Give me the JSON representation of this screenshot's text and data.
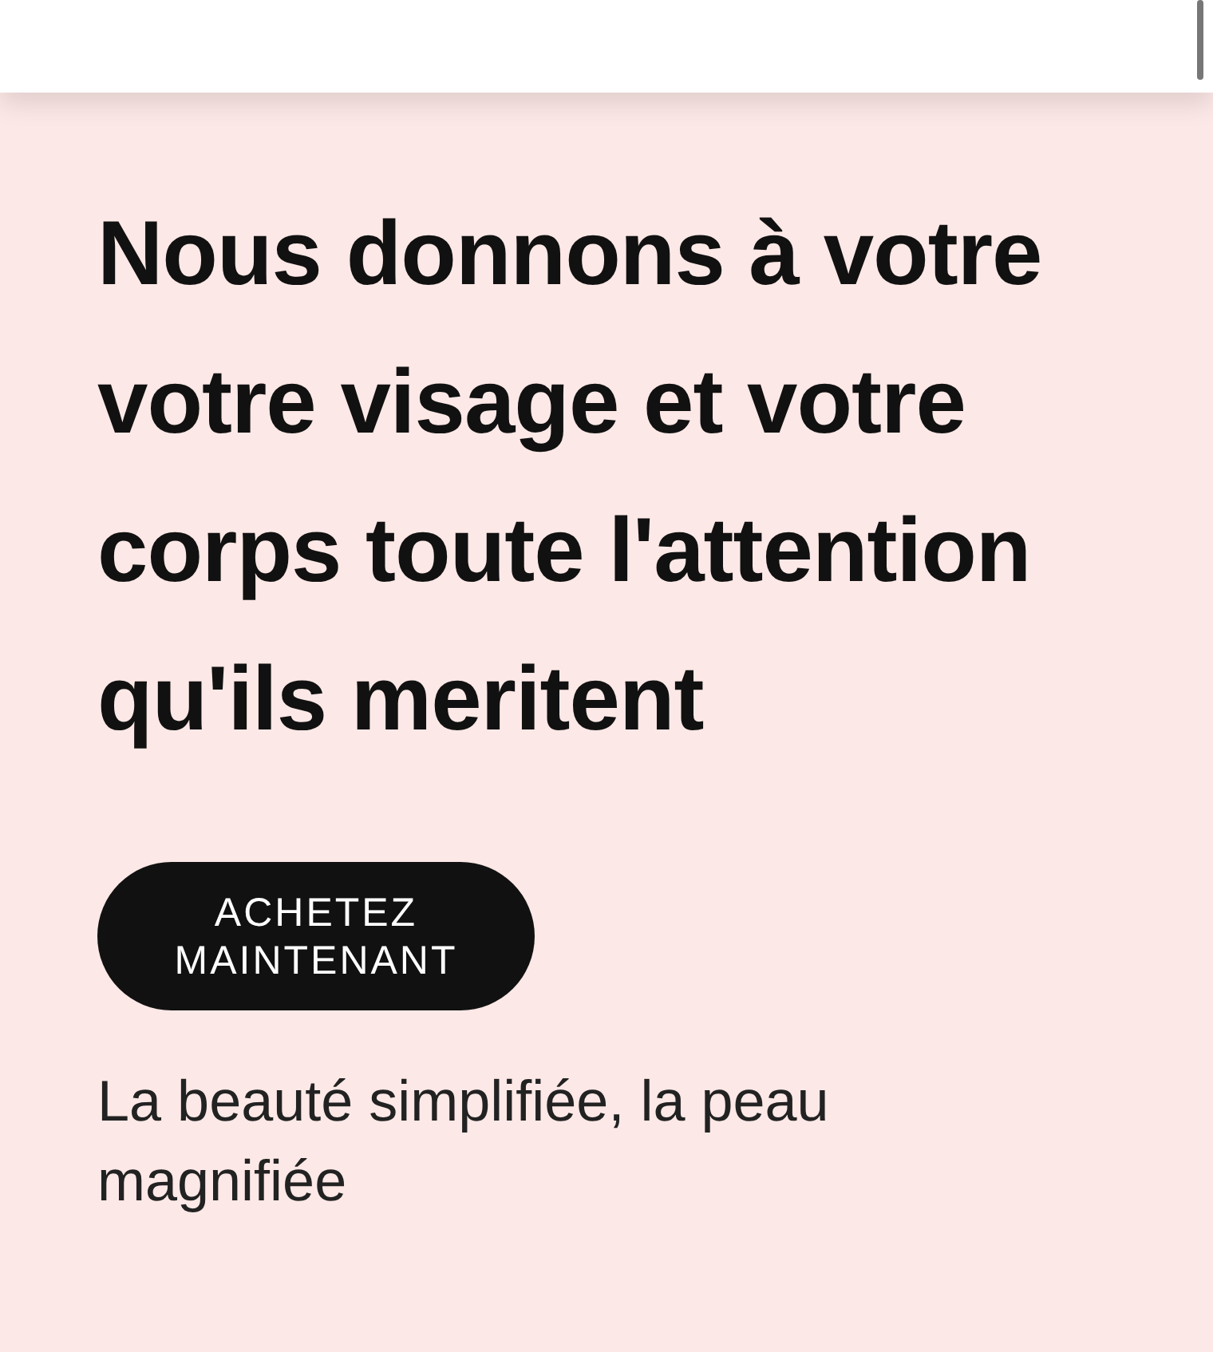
{
  "hero": {
    "heading": "Nous donnons à votre votre visage et votre corps toute l'attention qu'ils meritent",
    "button": "ACHETEZ MAINTENANT",
    "tagline": "La beauté simplifiée, la peau magnifiée"
  }
}
